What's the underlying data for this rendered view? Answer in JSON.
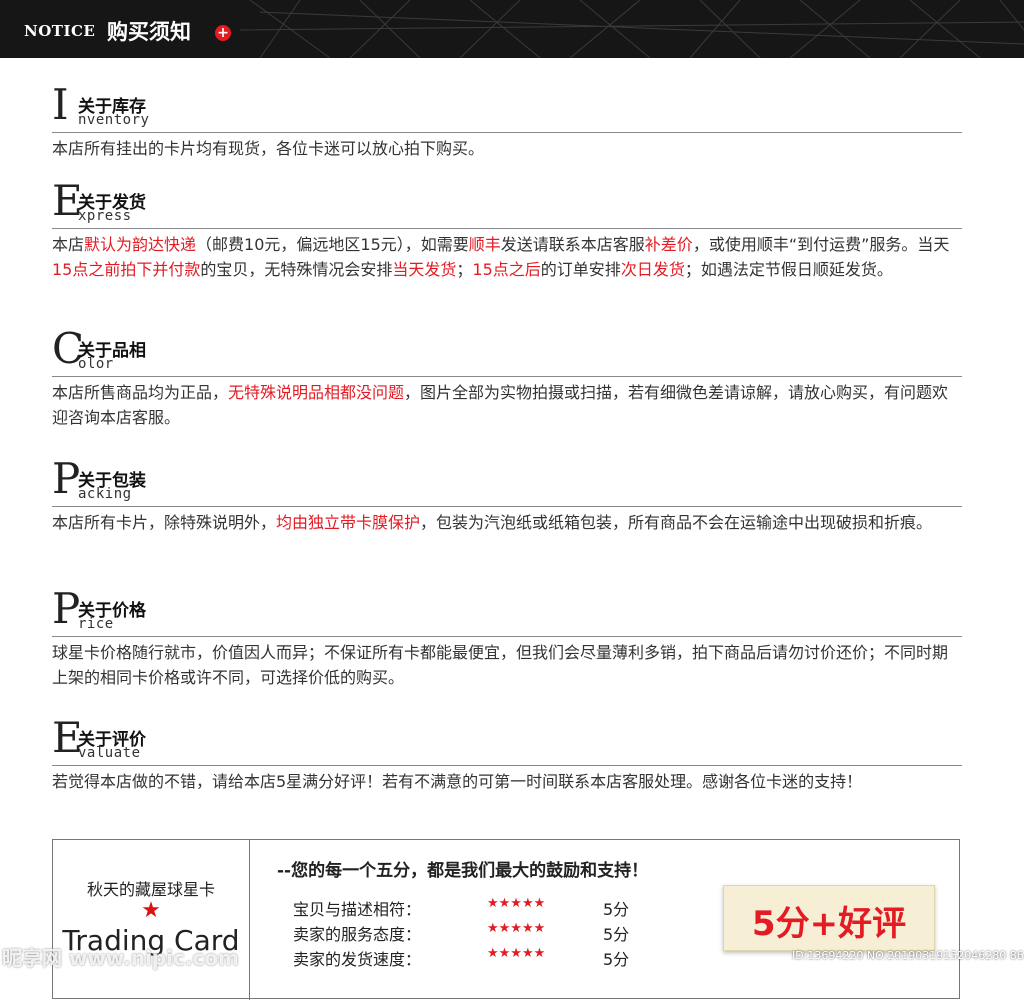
{
  "header": {
    "label_en": "NOTICE",
    "title": "购买须知",
    "plus": "+"
  },
  "sections": [
    {
      "initial": "I",
      "title": "关于库存",
      "rest": "nventory",
      "body": [
        {
          "t": "本店所有挂出的卡片均有现货，各位卡迷可以放心拍下购买。",
          "red": false
        }
      ]
    },
    {
      "initial": "E",
      "title": "关于发货",
      "rest": "xpress",
      "body": [
        {
          "t": "本店",
          "red": false
        },
        {
          "t": "默认为韵达快递",
          "red": true
        },
        {
          "t": "（邮费10元，偏远地区15元），如需要",
          "red": false
        },
        {
          "t": "顺丰",
          "red": true
        },
        {
          "t": "发送请联系本店客服",
          "red": false
        },
        {
          "t": "补差价",
          "red": true
        },
        {
          "t": "，或使用顺丰“到付运费”服务。当天",
          "red": false
        },
        {
          "t": "15点之前拍下并付款",
          "red": true
        },
        {
          "t": "的宝贝，无特殊情况会安排",
          "red": false
        },
        {
          "t": "当天发货",
          "red": true
        },
        {
          "t": "；",
          "red": false
        },
        {
          "t": "15点之后",
          "red": true
        },
        {
          "t": "的订单安排",
          "red": false
        },
        {
          "t": "次日发货",
          "red": true
        },
        {
          "t": "；如遇法定节假日顺延发货。",
          "red": false
        }
      ]
    },
    {
      "initial": "C",
      "title": "关于品相",
      "rest": "olor",
      "body": [
        {
          "t": "本店所售商品均为正品，",
          "red": false
        },
        {
          "t": "无特殊说明品相都没问题",
          "red": true
        },
        {
          "t": "，图片全部为实物拍摄或扫描，若有细微色差请谅解，请放心购买，有问题欢迎咨询本店客服。",
          "red": false
        }
      ]
    },
    {
      "initial": "P",
      "title": "关于包装",
      "rest": "acking",
      "body": [
        {
          "t": "本店所有卡片，除特殊说明外，",
          "red": false
        },
        {
          "t": "均由独立带卡膜保护",
          "red": true
        },
        {
          "t": "，包装为汽泡纸或纸箱包装，所有商品不会在运输途中出现破损和折痕。",
          "red": false
        }
      ]
    },
    {
      "initial": "P",
      "title": "关于价格",
      "rest": "rice",
      "body": [
        {
          "t": "球星卡价格随行就市，价值因人而异；不保证所有卡都能最便宜，但我们会尽量薄利多销，拍下商品后请勿讨价还价；不同时期上架的相同卡价格或许不同，可选择价低的购买。",
          "red": false
        }
      ]
    },
    {
      "initial": "E",
      "title": "关于评价",
      "rest": "valuate",
      "body": [
        {
          "t": "若觉得本店做的不错，请给本店5星满分好评！若有不满意的可第一时间联系本店客服处理。感谢各位卡迷的支持！",
          "red": false
        }
      ]
    }
  ],
  "footer": {
    "shop_name": "秋天的藏屋球星卡",
    "star": "★",
    "brand": "Trading Card",
    "slogan": "--您的每一个五分，都是我们最大的鼓励和支持！",
    "ratings": [
      {
        "label": "宝贝与描述相符：",
        "stars": "★★★★★",
        "score": "5分"
      },
      {
        "label": "卖家的服务态度：",
        "stars": "★★★★★",
        "score": "5分"
      },
      {
        "label": "卖家的发货速度：",
        "stars": "★★★★★",
        "score": "5分"
      }
    ],
    "badge": "5分+好评"
  },
  "watermarks": {
    "left": "昵享网 www.nipic.com",
    "right": "ID:13694220 NO:20190319152046280 86"
  },
  "colors": {
    "accent": "#e31c24",
    "header_bg": "#161616"
  }
}
